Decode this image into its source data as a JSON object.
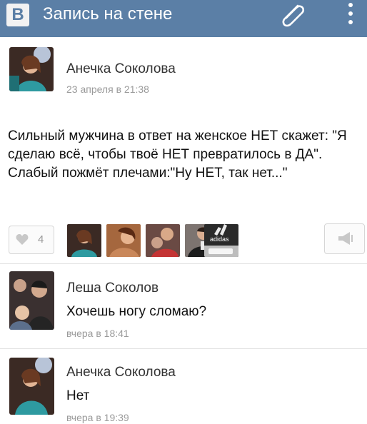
{
  "header": {
    "logo_letter": "В",
    "title": "Запись на стене",
    "attach_icon": "paperclip-icon",
    "menu_icon": "more-vertical-icon",
    "bg_color": "#5b7fa6"
  },
  "post": {
    "author": "Анечка Соколова",
    "date": "23 апреля в 21:38",
    "text": "Сильный мужчина в ответ на женское НЕТ скажет: \"Я сделаю всё, чтобы твоё НЕТ превратилось в ДА\". Слабый пожмёт плечами:\"Ну НЕТ, так нет...\"",
    "likes_count": "4",
    "like_icon": "heart-icon",
    "share_icon": "megaphone-icon",
    "liker_avatars": [
      "avatar-1",
      "avatar-2",
      "avatar-3",
      "avatar-4",
      "adidas-avatar"
    ],
    "liker_badge_text": "adidas"
  },
  "comments": [
    {
      "author": "Леша Соколов",
      "text": "Хочешь ногу сломаю?",
      "date": "вчера в 18:41"
    },
    {
      "author": "Анечка Соколова",
      "text": "Нет",
      "date": "вчера в 19:39"
    }
  ]
}
